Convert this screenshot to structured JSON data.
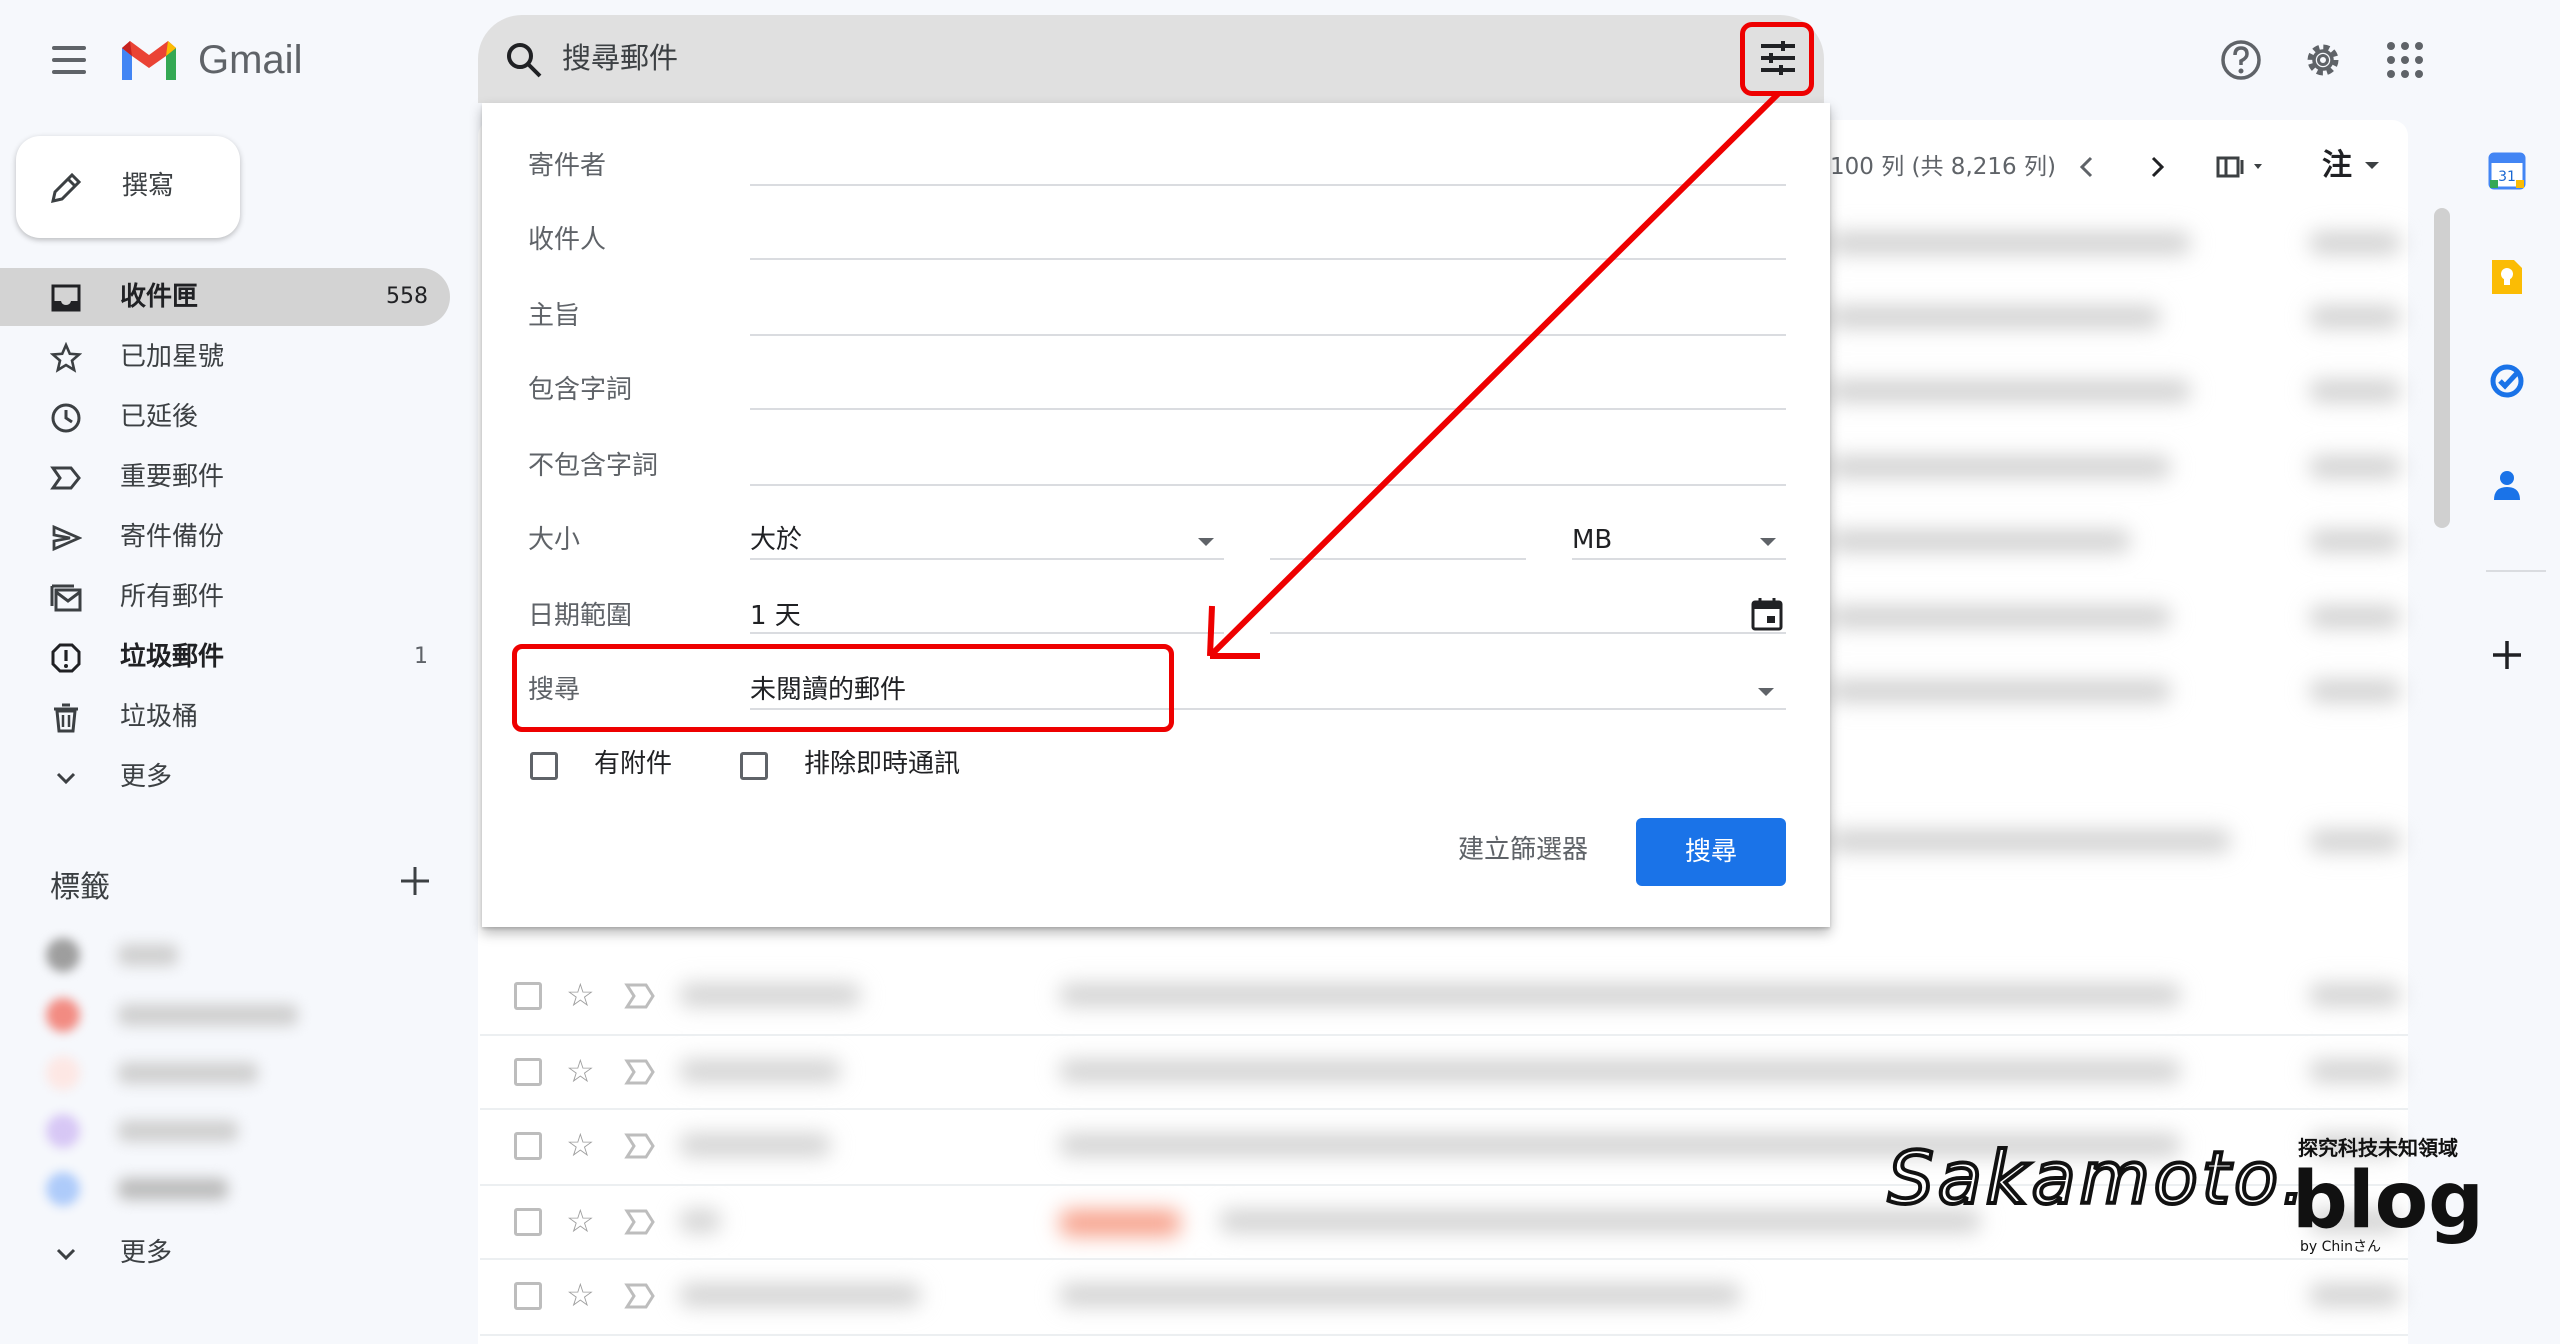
{
  "app": {
    "name": "Gmail"
  },
  "search": {
    "placeholder": "搜尋郵件"
  },
  "compose": {
    "label": "撰寫"
  },
  "sidebar": {
    "items": [
      {
        "label": "收件匣",
        "count": "558"
      },
      {
        "label": "已加星號",
        "count": ""
      },
      {
        "label": "已延後",
        "count": ""
      },
      {
        "label": "重要郵件",
        "count": ""
      },
      {
        "label": "寄件備份",
        "count": ""
      },
      {
        "label": "所有郵件",
        "count": ""
      },
      {
        "label": "垃圾郵件",
        "count": "1"
      },
      {
        "label": "垃圾桶",
        "count": ""
      },
      {
        "label": "更多",
        "count": ""
      }
    ],
    "labels_title": "標籤",
    "labels_more": "更多"
  },
  "toolbar": {
    "pagination": "100 列 (共 8,216 列)",
    "input_tool": "注"
  },
  "filter_panel": {
    "from_label": "寄件者",
    "to_label": "收件人",
    "subject_label": "主旨",
    "has_words_label": "包含字詞",
    "no_words_label": "不包含字詞",
    "size_label": "大小",
    "size_operator": "大於",
    "size_unit": "MB",
    "date_label": "日期範圍",
    "date_value": "1 天",
    "search_in_label": "搜尋",
    "search_in_value": "未閱讀的郵件",
    "has_attachment_label": "有附件",
    "exclude_chats_label": "排除即時通訊",
    "create_filter_label": "建立篩選器",
    "search_button_label": "搜尋"
  },
  "right_rail": {
    "calendar_day": "31"
  },
  "watermark": {
    "script": "Sakamoto.",
    "brand": "blog",
    "tagline": "探究科技未知領域",
    "by": "by Chinさん"
  },
  "colors": {
    "accent_blue": "#1a73e8",
    "highlight_red": "#e00000",
    "inbox_active_bg": "#d3d3d3"
  }
}
